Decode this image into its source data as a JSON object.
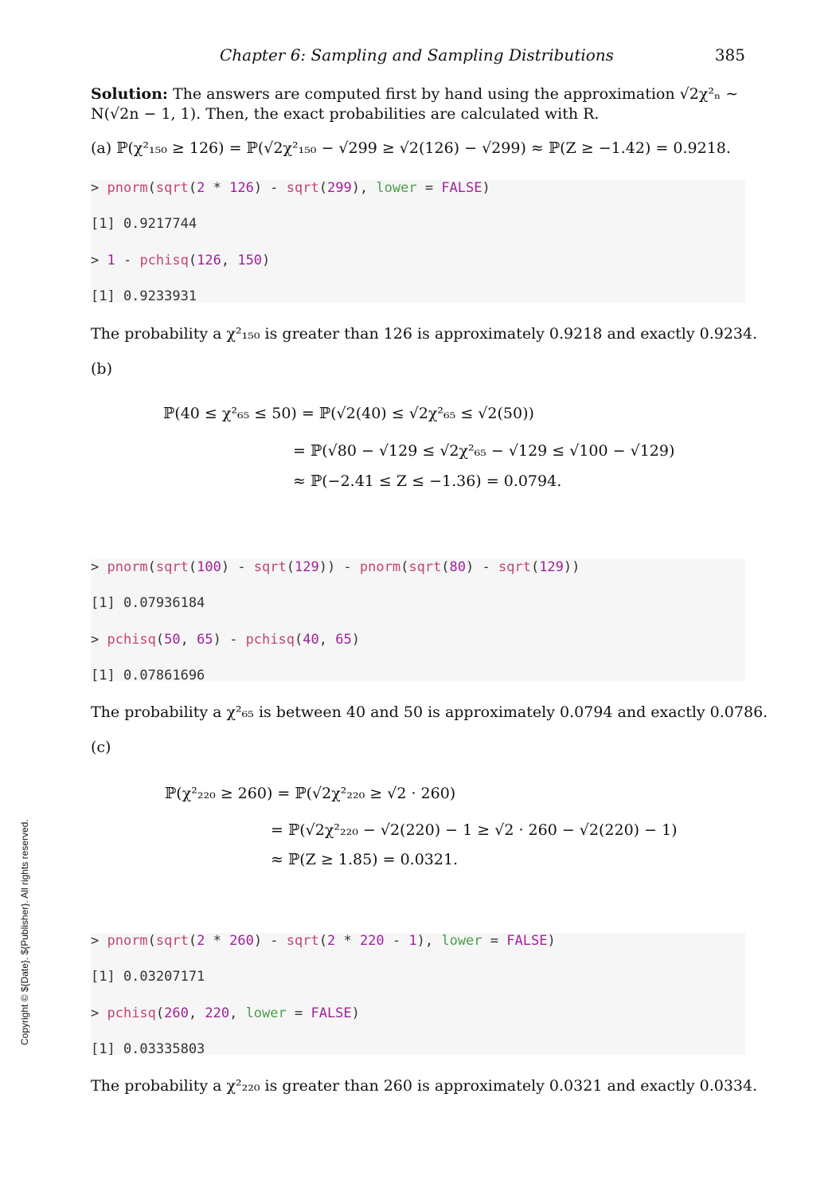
{
  "header": {
    "chapter": "Chapter 6: Sampling and Sampling Distributions",
    "page_number": "385"
  },
  "solution": {
    "label": "Solution:",
    "intro_line1": "The answers are computed first by hand using the approximation √2χ²ₙ ∼",
    "intro_line2": "N(√2n − 1, 1). Then, the exact probabilities are calculated with R."
  },
  "part_a": {
    "equation": "(a) ℙ(χ²₁₅₀ ≥ 126) = ℙ(√2χ²₁₅₀ − √299 ≥ √2(126) − √299) ≈ ℙ(Z ≥ −1.42) = 0.9218.",
    "code": [
      "> pnorm(sqrt(2 * 126) - sqrt(299), lower = FALSE)",
      "[1] 0.9217744",
      "> 1 - pchisq(126, 150)",
      "[1] 0.9233931"
    ],
    "conclusion": "The probability a χ²₁₅₀ is greater than 126 is approximately 0.9218 and exactly 0.9234."
  },
  "part_b": {
    "label": "(b)",
    "eq1": "ℙ(40 ≤ χ²₆₅ ≤ 50) = ℙ(√2(40) ≤ √2χ²₆₅ ≤ √2(50))",
    "eq2": "= ℙ(√80 − √129 ≤ √2χ²₆₅ − √129 ≤ √100 − √129)",
    "eq3": "≈ ℙ(−2.41 ≤ Z ≤ −1.36) = 0.0794.",
    "code": [
      "> pnorm(sqrt(100) - sqrt(129)) - pnorm(sqrt(80) - sqrt(129))",
      "[1] 0.07936184",
      "> pchisq(50, 65) - pchisq(40, 65)",
      "[1] 0.07861696"
    ],
    "conclusion": "The probability a χ²₆₅ is between 40 and 50 is approximately 0.0794 and exactly 0.0786."
  },
  "part_c": {
    "label": "(c)",
    "eq1": "ℙ(χ²₂₂₀ ≥ 260) = ℙ(√2χ²₂₂₀ ≥ √2 · 260)",
    "eq2": "= ℙ(√2χ²₂₂₀ − √2(220) − 1 ≥ √2 · 260 − √2(220) − 1)",
    "eq3": "≈ ℙ(Z ≥ 1.85) = 0.0321.",
    "code": [
      "> pnorm(sqrt(2 * 260) - sqrt(2 * 220 - 1), lower = FALSE)",
      "[1] 0.03207171",
      "> pchisq(260, 220, lower = FALSE)",
      "[1] 0.03335803"
    ],
    "conclusion": "The probability a χ²₂₂₀ is greater than 260 is approximately 0.0321 and exactly 0.0334."
  },
  "sidebar_copyright": "Copyright © ${Date}. ${Publisher}. All rights reserved."
}
